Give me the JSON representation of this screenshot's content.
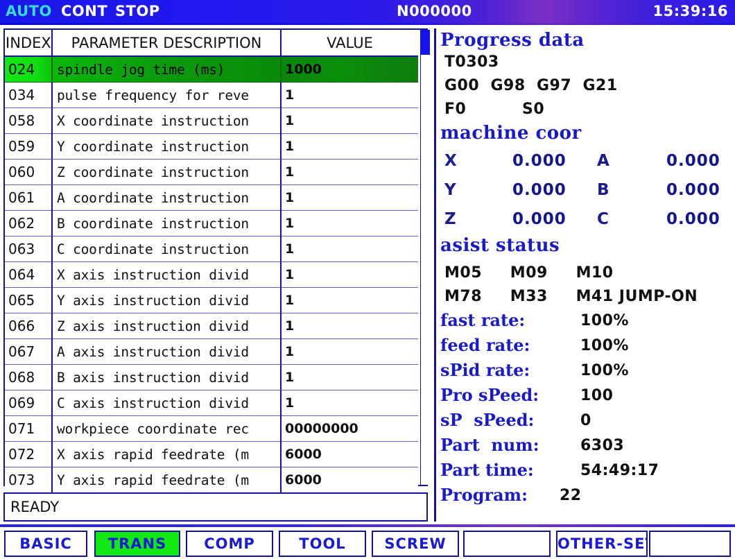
{
  "topbar": {
    "mode": "AUTO",
    "run_mode": "CONT",
    "run_state": "STOP",
    "block_number": "N000000",
    "clock": "15:39:16",
    "accent_cyan": "#35dcd0",
    "background": "#1a18e8"
  },
  "parameter_table": {
    "columns": [
      "INDEX",
      "PARAMETER DESCRIPTION",
      "VALUE"
    ],
    "selected_index": 0,
    "rows": [
      {
        "index": "024",
        "description": "spindle jog time (ms)",
        "value": "1000"
      },
      {
        "index": "034",
        "description": "pulse frequency for reve",
        "value": "1"
      },
      {
        "index": "058",
        "description": "X coordinate instruction",
        "value": "1"
      },
      {
        "index": "059",
        "description": "Y coordinate instruction",
        "value": "1"
      },
      {
        "index": "060",
        "description": "Z coordinate instruction",
        "value": "1"
      },
      {
        "index": "061",
        "description": "A coordinate instruction",
        "value": "1"
      },
      {
        "index": "062",
        "description": "B coordinate instruction",
        "value": "1"
      },
      {
        "index": "063",
        "description": "C coordinate instruction",
        "value": "1"
      },
      {
        "index": "064",
        "description": "X axis instruction divid",
        "value": "1"
      },
      {
        "index": "065",
        "description": "Y axis instruction divid",
        "value": "1"
      },
      {
        "index": "066",
        "description": "Z axis instruction divid",
        "value": "1"
      },
      {
        "index": "067",
        "description": "A axis instruction divid",
        "value": "1"
      },
      {
        "index": "068",
        "description": "B axis instruction divid",
        "value": "1"
      },
      {
        "index": "069",
        "description": "C axis instruction divid",
        "value": "1"
      },
      {
        "index": "071",
        "description": "workpiece coordinate rec",
        "value": "00000000"
      },
      {
        "index": "072",
        "description": "X axis rapid feedrate (m",
        "value": "6000"
      },
      {
        "index": "073",
        "description": "Y axis rapid feedrate (m",
        "value": "6000"
      }
    ]
  },
  "status": {
    "message": "READY"
  },
  "info_panel": {
    "progress_heading": "Progress data",
    "tool": "T0303",
    "g_codes": "G00  G98  G97  G21",
    "feed_code": "F0",
    "speed_code": "S0",
    "machine_coor_heading": "machine coor",
    "axes": [
      {
        "name": "X",
        "value": "0.000",
        "name2": "A",
        "value2": "0.000"
      },
      {
        "name": "Y",
        "value": "0.000",
        "name2": "B",
        "value2": "0.000"
      },
      {
        "name": "Z",
        "value": "0.000",
        "name2": "C",
        "value2": "0.000"
      }
    ],
    "assist_heading": "asist status",
    "m_codes_row1": "M05     M09     M10",
    "m_codes_row2": "M78     M33     M41 JUMP-ON",
    "rates": [
      {
        "label": "fast rate:",
        "value": "100%"
      },
      {
        "label": "feed rate:",
        "value": "100%"
      },
      {
        "label": "sPid rate:",
        "value": "100%"
      }
    ],
    "readouts": [
      {
        "label": "Pro sPeed:",
        "value": "100"
      },
      {
        "label": "sP  sPeed:",
        "value": "0"
      },
      {
        "label": "Part  num:",
        "value": "6303"
      },
      {
        "label": "Part time:",
        "value": "54:49:17"
      },
      {
        "label": "Program:",
        "value": "22"
      }
    ]
  },
  "softkeys": [
    {
      "label": "BASIC",
      "active": false
    },
    {
      "label": "TRANS",
      "active": true
    },
    {
      "label": "COMP",
      "active": false
    },
    {
      "label": "TOOL",
      "active": false
    },
    {
      "label": "SCREW",
      "active": false
    },
    {
      "label": "",
      "active": false
    },
    {
      "label": "OTHER-SET",
      "active": false
    },
    {
      "label": "",
      "active": false
    }
  ]
}
